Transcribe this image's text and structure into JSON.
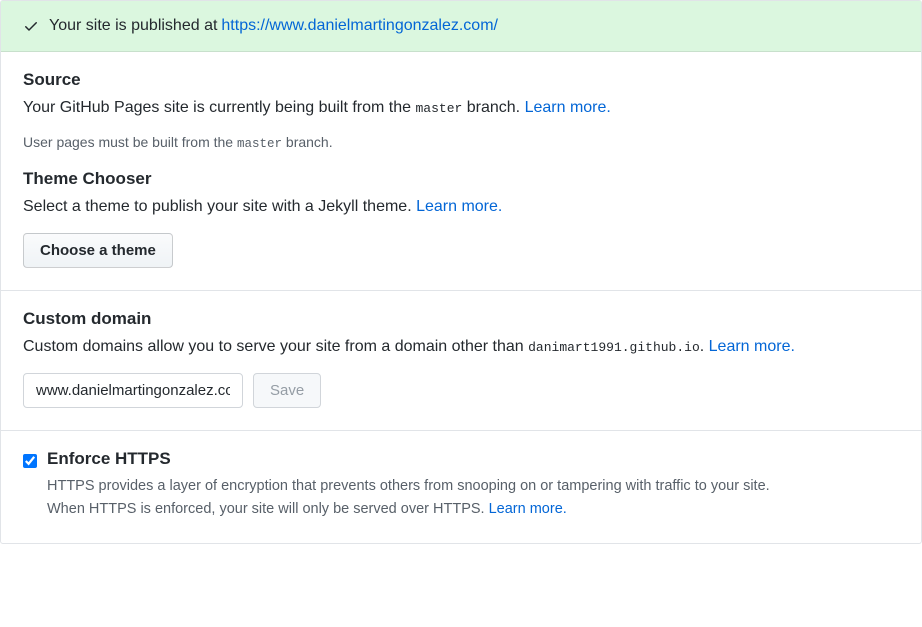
{
  "flash": {
    "prefix": "Your site is published at",
    "url": "https://www.danielmartingonzalez.com/"
  },
  "source": {
    "heading": "Source",
    "desc_prefix": "Your GitHub Pages site is currently being built from the ",
    "branch_code": "master",
    "desc_suffix": " branch. ",
    "learn_more": "Learn more",
    "note_prefix": "User pages must be built from the ",
    "note_code": "master",
    "note_suffix": " branch."
  },
  "theme": {
    "heading": "Theme Chooser",
    "desc": "Select a theme to publish your site with a Jekyll theme. ",
    "learn_more": "Learn more",
    "button": "Choose a theme"
  },
  "custom_domain": {
    "heading": "Custom domain",
    "desc_prefix": "Custom domains allow you to serve your site from a domain other than ",
    "code": "danimart1991.github.io",
    "desc_suffix": ". ",
    "learn_more": "Learn more",
    "input_value": "www.danielmartingonzalez.com",
    "save_label": "Save"
  },
  "https": {
    "heading": "Enforce HTTPS",
    "line1": "HTTPS provides a layer of encryption that prevents others from snooping on or tampering with traffic to your site.",
    "line2_prefix": "When HTTPS is enforced, your site will only be served over HTTPS. ",
    "learn_more": "Learn more"
  }
}
